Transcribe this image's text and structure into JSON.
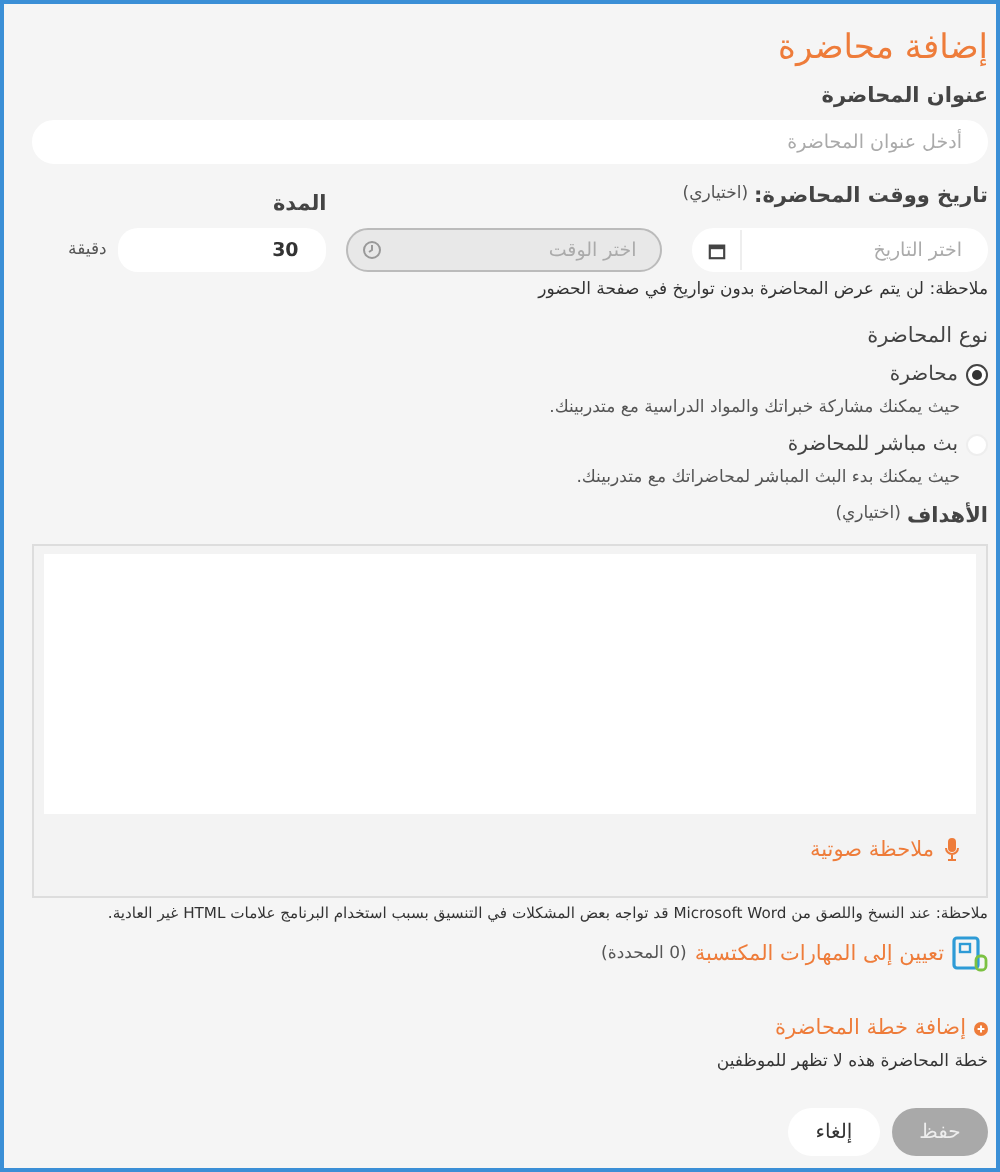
{
  "title": "إضافة محاضرة",
  "lecture_title": {
    "label": "عنوان المحاضرة",
    "placeholder": "أدخل عنوان المحاضرة"
  },
  "schedule": {
    "label": "تاريخ ووقت المحاضرة:",
    "optional": "(اختياري)",
    "date": {
      "placeholder": "اختر التاريخ"
    },
    "time": {
      "placeholder": "اختر الوقت",
      "disabled": true
    },
    "note": "ملاحظة: لن يتم عرض المحاضرة بدون تواريخ في صفحة الحضور"
  },
  "duration": {
    "label": "المدة",
    "value": "30",
    "unit": "دقيقة"
  },
  "lecture_type": {
    "label": "نوع المحاضرة",
    "options": [
      {
        "label": "محاضرة",
        "description": "حيث يمكنك مشاركة خبراتك والمواد الدراسية مع متدربينك.",
        "selected": true
      },
      {
        "label": "بث مباشر للمحاضرة",
        "description": "حيث يمكنك بدء البث المباشر لمحاضراتك مع متدربينك.",
        "selected": false
      }
    ]
  },
  "goals": {
    "label": "الأهداف",
    "optional": "(اختياري)",
    "voice_note": "ملاحظة صوتية",
    "note": "ملاحظة: عند النسخ واللصق من Microsoft Word قد تواجه بعض المشكلات في التنسيق بسبب استخدام البرنامج علامات HTML غير العادية."
  },
  "skills": {
    "link": "تعيين إلى المهارات المكتسبة",
    "count": "(0 المحددة)"
  },
  "plan": {
    "link": "إضافة خطة المحاضرة",
    "note": "خطة المحاضرة هذه لا تظهر للموظفين"
  },
  "buttons": [
    {
      "label": "حفظ",
      "kind": "primary",
      "disabled": true
    },
    {
      "label": "إلغاء",
      "kind": "secondary",
      "disabled": false
    }
  ]
}
